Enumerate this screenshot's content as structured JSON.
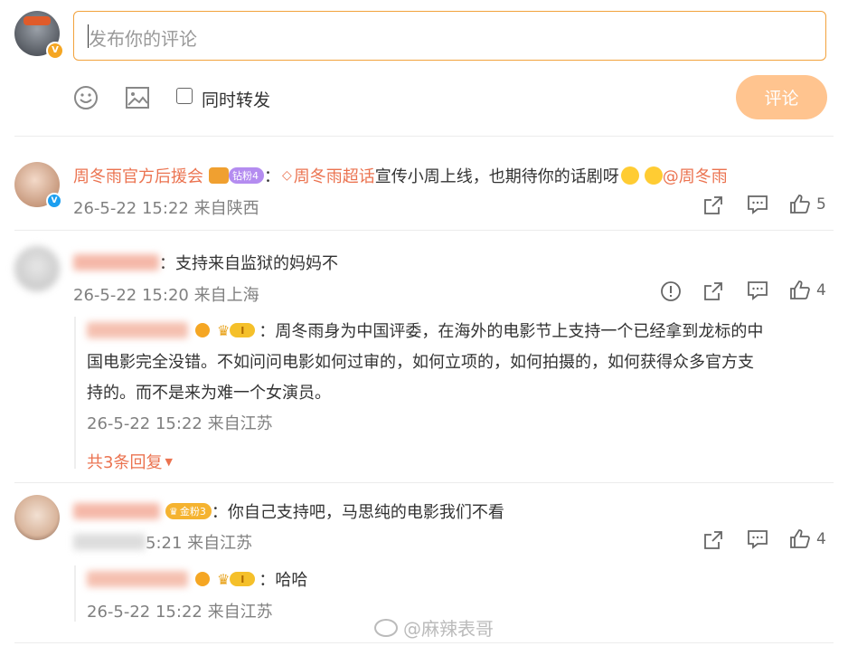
{
  "composer": {
    "placeholder": "发布你的评论",
    "forward_label": "同时转发",
    "submit_label": "评论"
  },
  "colors": {
    "accent": "#eb7350",
    "submit_bg": "#ffc48f",
    "input_border": "#f2a23c"
  },
  "comments": [
    {
      "user": "周冬雨官方后援会",
      "badge": "钻粉4",
      "text_pre": "：",
      "topic": "周冬雨超话",
      "text": " 宣传小周上线，也期待你的话剧呀",
      "mention": "@周冬雨",
      "meta": "26-5-22 15:22 来自陕西",
      "likes": "5",
      "icons": [
        "share-icon",
        "comment-icon",
        "like-icon"
      ]
    },
    {
      "user": "",
      "text": "：支持来自监狱的妈妈不",
      "meta": "26-5-22 15:20 来自上海",
      "likes": "4",
      "reply": {
        "user": "Iam",
        "user_suffix": "超凶",
        "badge": "I",
        "text_line1": "：周冬雨身为中国评委，在海外的电影节上支持一个已经拿到龙标的中",
        "text_line2": "国电影完全没错。不如问问电影如何过审的，如何立项的，如何拍摄的，如何获得众多官方支",
        "text_line3": "持的。而不是来为难一个女演员。",
        "meta": "26-5-22 15:22 来自江苏"
      },
      "more_replies": "共3条回复"
    },
    {
      "user": "",
      "badge": "金粉3",
      "text": "：你自己支持吧，马思纯的电影我们不看",
      "meta_visible": "5:21 来自江苏",
      "likes": "4",
      "reply": {
        "user": "Iam",
        "user_suffix": "超凶",
        "badge": "I",
        "text": "：哈哈",
        "meta": "26-5-22 15:22 来自江苏"
      }
    }
  ],
  "watermark": "@麻辣表哥"
}
